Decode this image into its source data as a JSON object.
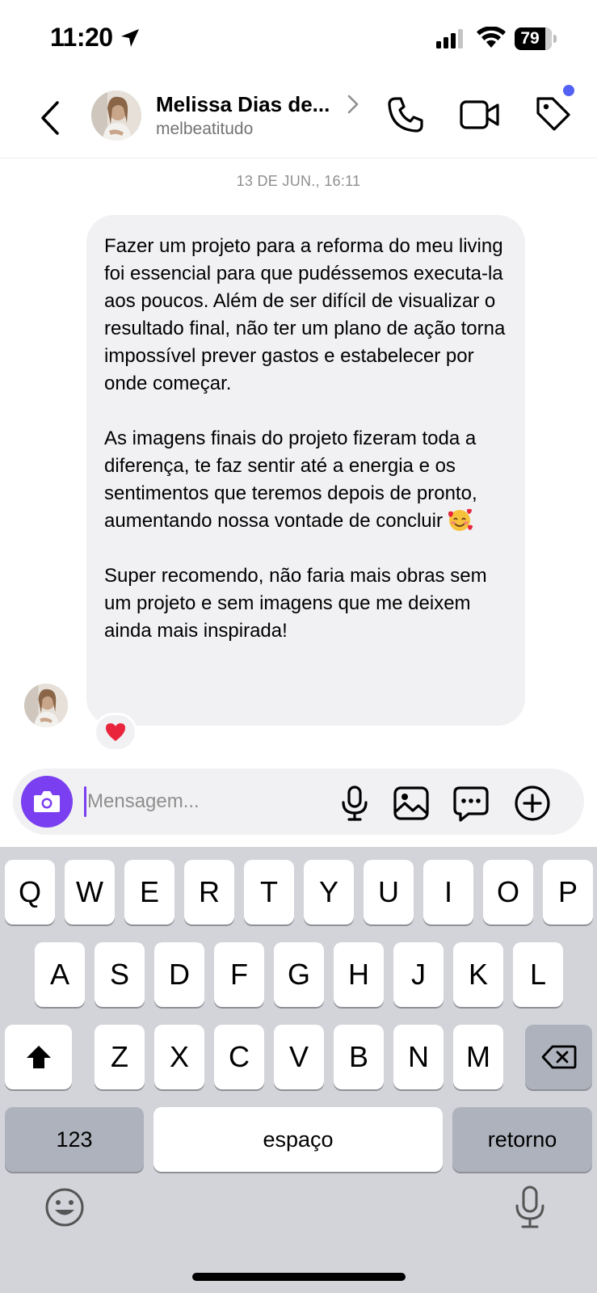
{
  "status_bar": {
    "time": "11:20",
    "battery": "79",
    "icons": [
      "location-arrow-icon",
      "cellular-signal-icon",
      "wifi-icon",
      "battery-icon"
    ]
  },
  "header": {
    "contact_name": "Melissa Dias de...",
    "contact_handle": "melbeatitudo",
    "icons": [
      "back-chevron-icon",
      "avatar",
      "chevron-right-icon",
      "phone-icon",
      "video-camera-icon",
      "tag-icon"
    ],
    "notification_dot_color": "#5461f5"
  },
  "chat": {
    "timestamp": "13 DE JUN., 16:11",
    "message": {
      "paragraph_1": "Fazer um projeto para a reforma do meu living foi essencial para que pudéssemos executa-la aos poucos. Além de ser difícil de visualizar o resultado final, não ter um plano de ação torna impossível prever gastos e estabelecer por onde começar.",
      "paragraph_2": "As imagens finais do projeto fizeram toda a diferença, te faz sentir até a energia e os sentimentos que teremos depois de pronto, aumentando nossa vontade de concluir",
      "paragraph_2_emoji": "smiling-face-with-hearts-emoji",
      "paragraph_3": "Super recomendo, não faria mais obras sem um projeto e sem imagens que me deixem ainda mais inspirada!"
    },
    "reaction": "heart-emoji"
  },
  "composer": {
    "placeholder": "Mensagem...",
    "accent_color": "#7a3ff0",
    "icons": [
      "camera-icon",
      "microphone-icon",
      "gallery-icon",
      "sticker-chat-icon",
      "plus-circle-icon"
    ]
  },
  "keyboard": {
    "row1": [
      "Q",
      "W",
      "E",
      "R",
      "T",
      "Y",
      "U",
      "I",
      "O",
      "P"
    ],
    "row2": [
      "A",
      "S",
      "D",
      "F",
      "G",
      "H",
      "J",
      "K",
      "L"
    ],
    "row3": [
      "Z",
      "X",
      "C",
      "V",
      "B",
      "N",
      "M"
    ],
    "numbers_key": "123",
    "space_key": "espaço",
    "return_key": "retorno",
    "icons": [
      "shift-icon",
      "backspace-icon",
      "emoji-icon",
      "dictation-microphone-icon"
    ]
  }
}
